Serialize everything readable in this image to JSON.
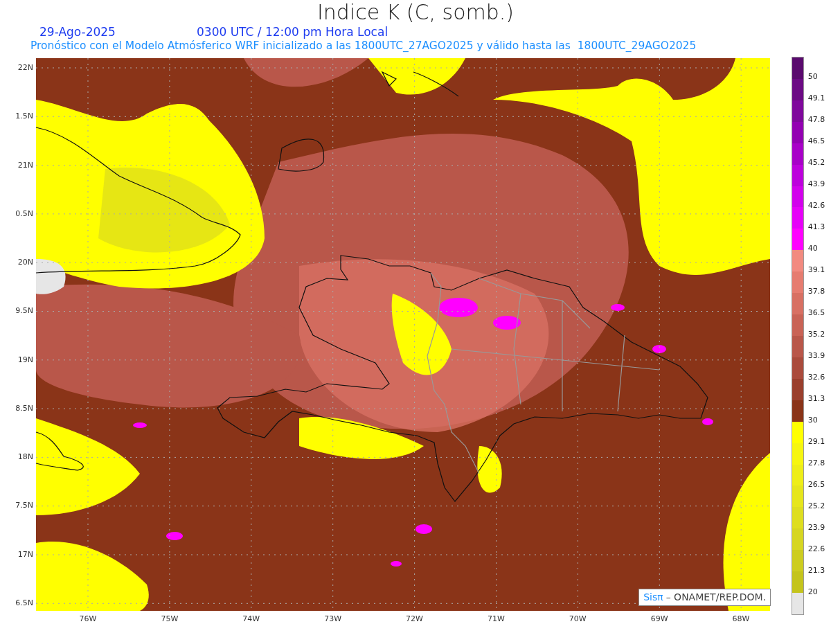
{
  "title": "Indice K (C, somb.)",
  "date": "29-Ago-2025",
  "time": "0300 UTC / 12:00 pm Hora Local",
  "subtitle": "Pronóstico con el Modelo Atmósferico WRF inicializado a las 1800UTC_27AGO2025 y válido hasta las  1800UTC_29AGO2025",
  "y_axis": [
    "22N",
    "1.5N",
    "21N",
    "0.5N",
    "20N",
    "9.5N",
    "19N",
    "8.5N",
    "18N",
    "7.5N",
    "17N",
    "6.5N"
  ],
  "x_axis": [
    "76W",
    "75W",
    "74W",
    "73W",
    "72W",
    "71W",
    "70W",
    "69W",
    "68W"
  ],
  "colorbar": {
    "segments": [
      {
        "color": "#5a0a6e"
      },
      {
        "color": "#6c0a84"
      },
      {
        "color": "#7f089c"
      },
      {
        "color": "#9300b2"
      },
      {
        "color": "#a800c8"
      },
      {
        "color": "#bd00dc"
      },
      {
        "color": "#d200ec"
      },
      {
        "color": "#e600f8"
      },
      {
        "color": "#ff00ff"
      },
      {
        "color": "#f28a80"
      },
      {
        "color": "#e67c70"
      },
      {
        "color": "#d87063"
      },
      {
        "color": "#c96356"
      },
      {
        "color": "#b9574a"
      },
      {
        "color": "#aa4b3c"
      },
      {
        "color": "#9a3f2d"
      },
      {
        "color": "#8a3418"
      },
      {
        "color": "#ffff00"
      },
      {
        "color": "#f6f610"
      },
      {
        "color": "#eeee18"
      },
      {
        "color": "#e6e61c"
      },
      {
        "color": "#dede20"
      },
      {
        "color": "#d6d622"
      },
      {
        "color": "#cdcd20"
      },
      {
        "color": "#c4c41c"
      },
      {
        "color": "#e6e6e6"
      }
    ],
    "labels": [
      "50",
      "49.1",
      "47.8",
      "46.5",
      "45.2",
      "43.9",
      "42.6",
      "41.3",
      "40",
      "39.1",
      "37.8",
      "36.5",
      "35.2",
      "33.9",
      "32.6",
      "31.3",
      "30",
      "29.1",
      "27.8",
      "26.5",
      "25.2",
      "23.9",
      "22.6",
      "21.3",
      "20"
    ]
  },
  "credit": {
    "brand": "Sisπ",
    "text": "– ONAMET/REP.DOM."
  }
}
